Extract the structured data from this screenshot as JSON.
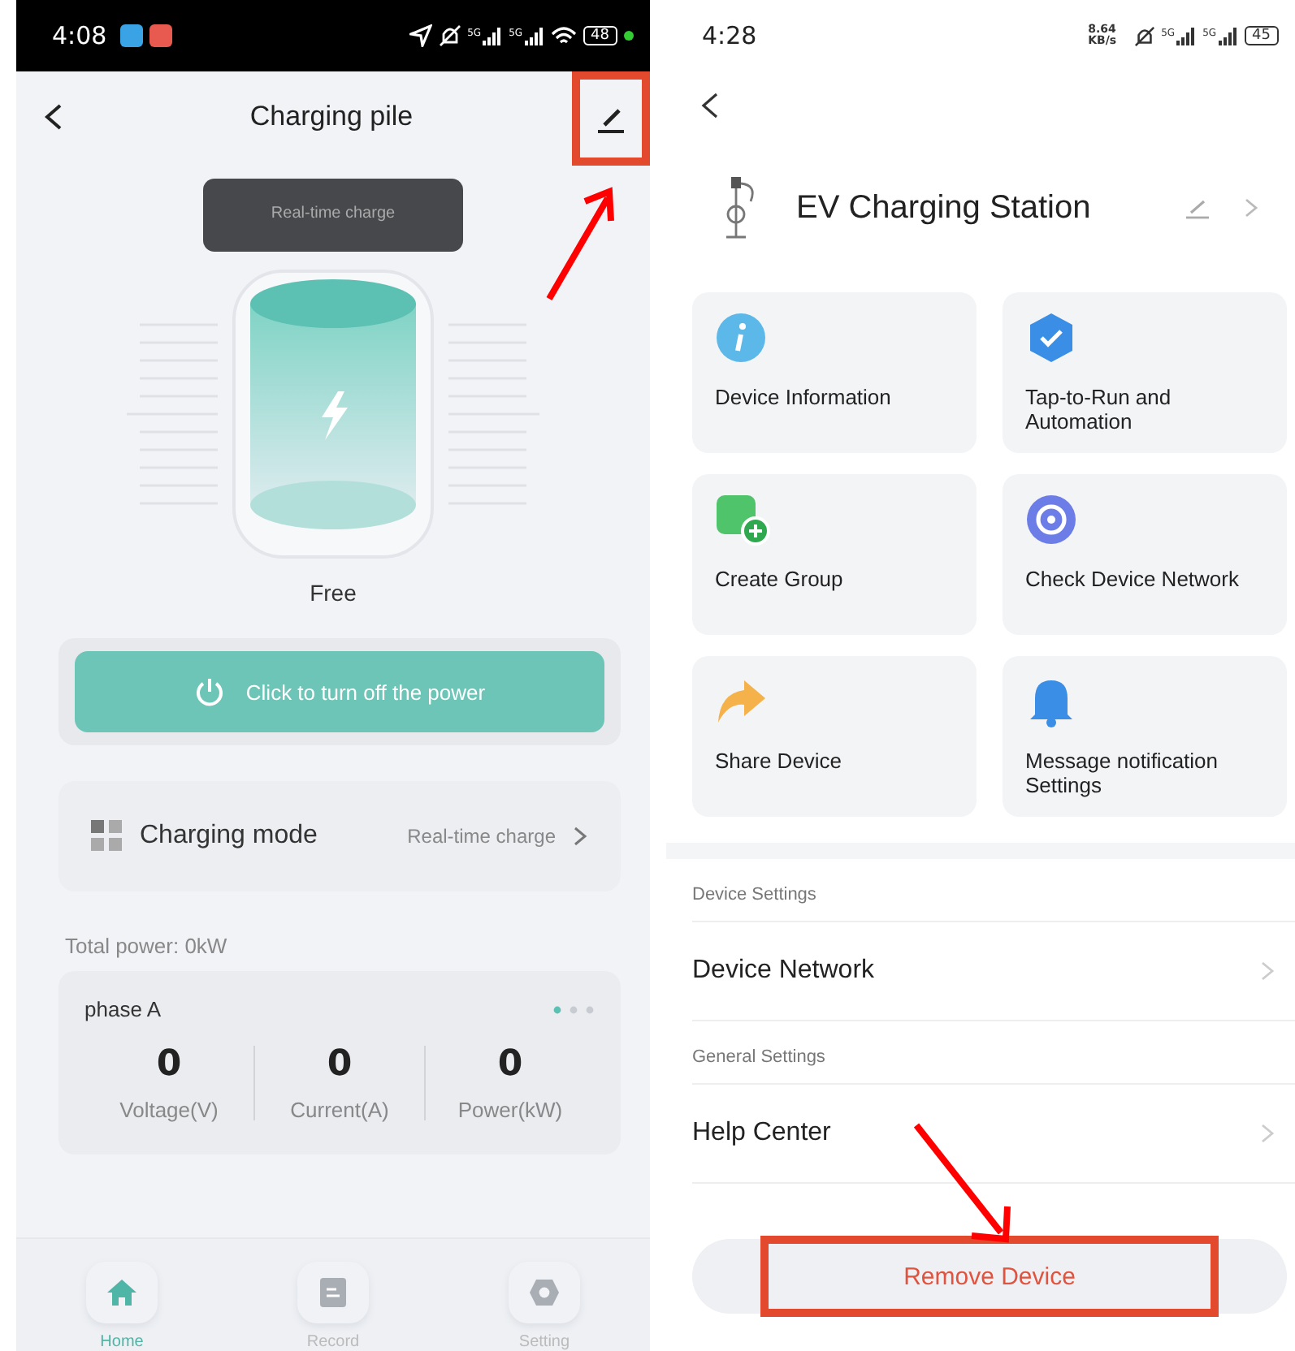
{
  "left_screen": {
    "status_bar": {
      "time": "4:08",
      "signal_labels": [
        "5G",
        "5G"
      ],
      "battery": "48"
    },
    "header": {
      "title": "Charging pile"
    },
    "tooltip": "Real-time charge",
    "status_text": "Free",
    "power_button": "Click to turn off the power",
    "charging_mode": {
      "label": "Charging mode",
      "value": "Real-time charge"
    },
    "total_power": "Total power:  0kW",
    "phase": {
      "title": "phase A",
      "readings": [
        {
          "value": "0",
          "label": "Voltage(V)"
        },
        {
          "value": "0",
          "label": "Current(A)"
        },
        {
          "value": "0",
          "label": "Power(kW)"
        }
      ]
    },
    "bottom_nav": [
      {
        "kind": "home",
        "label": "Home",
        "selected": true
      },
      {
        "kind": "record",
        "label": "Record",
        "selected": false
      },
      {
        "kind": "setting",
        "label": "Setting",
        "selected": false
      }
    ]
  },
  "right_screen": {
    "status_bar": {
      "time": "4:28",
      "speed": "8.64 KB/s",
      "signal_labels": [
        "5G",
        "5G"
      ],
      "battery": "45"
    },
    "device": {
      "name": "EV Charging Station"
    },
    "tiles": [
      {
        "kind": "info",
        "label": "Device Information"
      },
      {
        "kind": "automation",
        "label": "Tap-to-Run and Automation"
      },
      {
        "kind": "group",
        "label": "Create Group"
      },
      {
        "kind": "network",
        "label": "Check Device Network"
      },
      {
        "kind": "share",
        "label": "Share Device"
      },
      {
        "kind": "bell",
        "label": "Message notification Settings"
      }
    ],
    "sections": [
      {
        "title": "Device Settings",
        "rows": [
          "Device Network"
        ]
      },
      {
        "title": "General Settings",
        "rows": [
          "Help Center"
        ]
      }
    ],
    "remove_button": "Remove Device"
  }
}
